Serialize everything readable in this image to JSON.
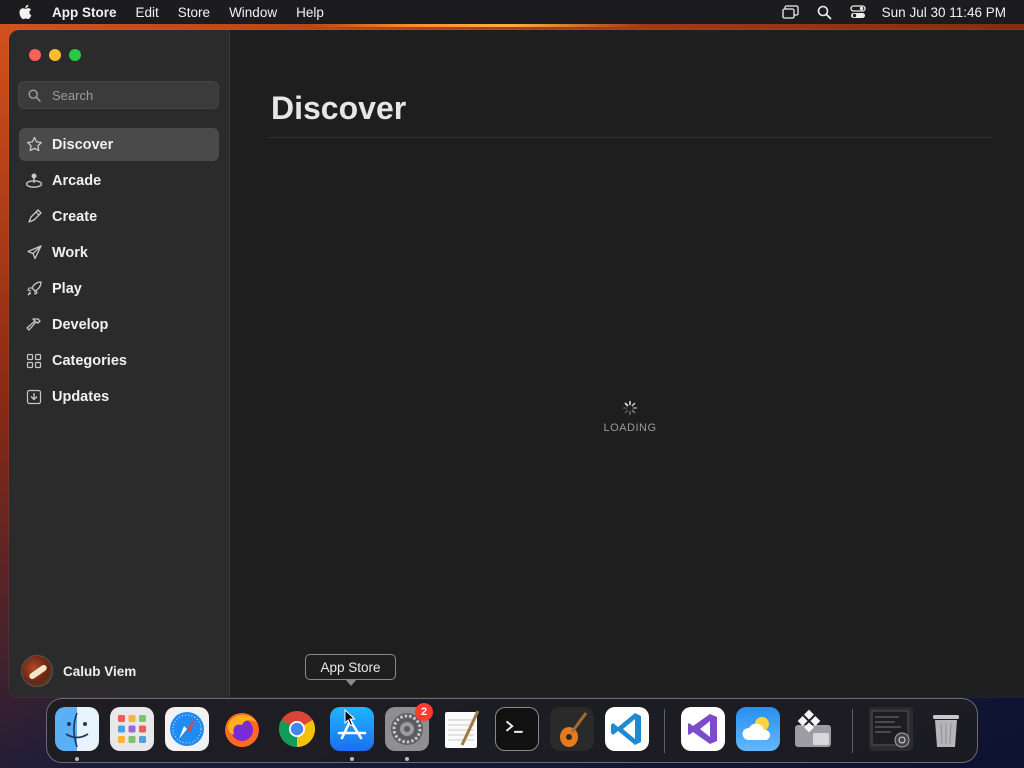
{
  "menubar": {
    "app_name": "App Store",
    "items": [
      "Edit",
      "Store",
      "Window",
      "Help"
    ],
    "clock": "Sun Jul 30  11:46 PM",
    "status_icons": [
      "screen-mirroring-icon",
      "spotlight-search-icon",
      "control-center-icon"
    ]
  },
  "window": {
    "traffic_lights": [
      "close",
      "minimize",
      "maximize"
    ]
  },
  "sidebar": {
    "search": {
      "placeholder": "Search",
      "value": ""
    },
    "items": [
      {
        "label": "Discover",
        "icon": "star-icon",
        "active": true
      },
      {
        "label": "Arcade",
        "icon": "joystick-icon",
        "active": false
      },
      {
        "label": "Create",
        "icon": "brush-icon",
        "active": false
      },
      {
        "label": "Work",
        "icon": "paper-plane-icon",
        "active": false
      },
      {
        "label": "Play",
        "icon": "rocket-icon",
        "active": false
      },
      {
        "label": "Develop",
        "icon": "hammer-icon",
        "active": false
      },
      {
        "label": "Categories",
        "icon": "grid-icon",
        "active": false
      },
      {
        "label": "Updates",
        "icon": "download-icon",
        "active": false
      }
    ],
    "profile": {
      "name": "Calub Viem"
    }
  },
  "main": {
    "title": "Discover",
    "loading_text": "LOADING"
  },
  "tooltip": {
    "label": "App Store"
  },
  "dock": {
    "apps": [
      {
        "name": "Finder",
        "running": true
      },
      {
        "name": "Launchpad",
        "running": false
      },
      {
        "name": "Safari",
        "running": false
      },
      {
        "name": "Firefox",
        "running": false
      },
      {
        "name": "Google Chrome",
        "running": false
      },
      {
        "name": "App Store",
        "running": true
      },
      {
        "name": "System Settings",
        "running": true,
        "badge": "2"
      },
      {
        "name": "TextEdit",
        "running": false
      },
      {
        "name": "Terminal",
        "running": false
      },
      {
        "name": "GarageBand",
        "running": false
      },
      {
        "name": "Visual Studio Code",
        "running": false
      },
      {
        "name": "Visual Studio",
        "running": false
      },
      {
        "name": "Weather",
        "running": false
      },
      {
        "name": "Boot Camp Assistant",
        "running": false
      },
      {
        "name": "Downloads",
        "running": false
      },
      {
        "name": "Trash",
        "running": false
      }
    ]
  },
  "colors": {
    "close": "#fe5f57",
    "minimize": "#febc2e",
    "maximize": "#28c840",
    "badge": "#ff3b30",
    "sidebar_bg": "#2b2b2b",
    "active_item_bg": "#4a4a4a"
  }
}
